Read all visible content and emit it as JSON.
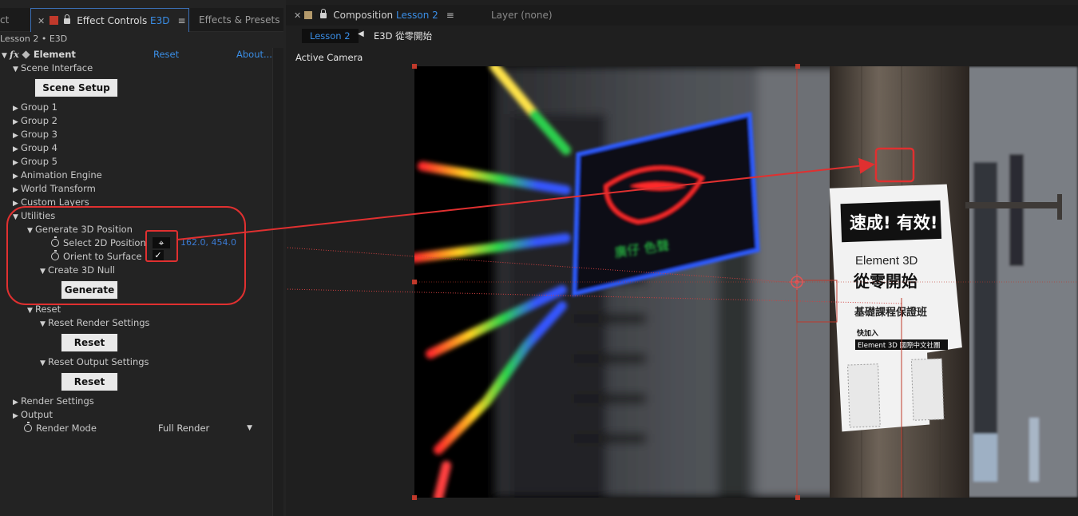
{
  "left_panel": {
    "tabs": [
      {
        "label": "ct"
      },
      {
        "label": "Effect Controls",
        "suffix": "E3D"
      },
      {
        "label": "Effects & Presets"
      }
    ],
    "breadcrumb": "Lesson 2 • E3D",
    "effect": {
      "name": "Element",
      "reset": "Reset",
      "about": "About..."
    },
    "items": {
      "scene_interface": "Scene Interface",
      "scene_setup_button": "Scene Setup",
      "group1": "Group 1",
      "group2": "Group 2",
      "group3": "Group 3",
      "group4": "Group 4",
      "group5": "Group 5",
      "animation_engine": "Animation Engine",
      "world_transform": "World Transform",
      "custom_layers": "Custom Layers",
      "utilities": "Utilities",
      "generate_3d_position": "Generate 3D Position",
      "select_2d_position": "Select 2D Position",
      "select_2d_value": "162.0, 454.0",
      "orient_to_surface": "Orient to Surface",
      "create_3d_null": "Create 3D Null",
      "generate_button": "Generate",
      "reset_group": "Reset",
      "reset_render_settings": "Reset Render Settings",
      "reset_button_1": "Reset",
      "reset_output_settings": "Reset Output Settings",
      "reset_button_2": "Reset",
      "render_settings": "Render Settings",
      "output": "Output",
      "render_mode": "Render Mode",
      "render_mode_value": "Full Render"
    }
  },
  "right_panel": {
    "composition_tab": {
      "label": "Composition",
      "suffix": "Lesson 2"
    },
    "layer_tab": "Layer  (none)",
    "lesson_tab": "Lesson 2",
    "comp_name": "E3D 從零開始",
    "camera_label": "Active Camera"
  },
  "scene": {
    "poster_headline": "速成! 有效!",
    "poster_title_1": "Element 3D",
    "poster_title_2": "從零開始",
    "poster_subtitle": "基礎課程保證班",
    "poster_join": "快加入",
    "poster_group": "Element 3D 國際中文社團",
    "neon_text": "廣仔  色聲"
  },
  "colors": {
    "accent_blue": "#3a8ee6",
    "annotation_red": "#e03030",
    "panel_bg": "#232323"
  }
}
